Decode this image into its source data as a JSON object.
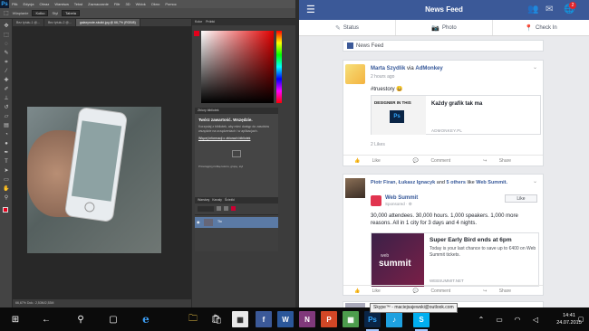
{
  "photoshop": {
    "logo": "Ps",
    "menu": [
      "Plik",
      "Edycja",
      "Obraz",
      "Warstwa",
      "Tekst",
      "Zaznaczanie",
      "Filtr",
      "3D",
      "Widok",
      "Okno",
      "Pomoc"
    ],
    "options": {
      "mode_label": "Wtapianie",
      "mode_value": "Kolko",
      "style_label": "Styl",
      "style_value": "Tabela"
    },
    "tabs": [
      "Bez tytułu-1 @...",
      "Bez tytułu-2 @...",
      "galaxynote-skutki.jpg @ 66,7% (RGB/8)"
    ],
    "status": "66,67%   Dok.: 2,53M/2,53M",
    "panels": {
      "color_tab": "Kolor",
      "swatches_tab": "Próbki",
      "library_tab": "Zbiory bibliotek",
      "layers_tab": "Warstwy",
      "channels_tab": "Kanały",
      "paths_tab": "Ścieżki"
    },
    "library": {
      "heading": "Twórz zawartość. Wszędzie.",
      "body": "Korzystaj z bibliotek, aby mieć dostęp do zasobów wszędzie na urządzeniach i w aplikacjach.",
      "link": "Więcej informacji o zbiorach bibliotek",
      "footer": "Przeciągnij próbkę koloru, grupę, styl"
    },
    "layer_name": "Tło"
  },
  "facebook": {
    "title": "News Feed",
    "actions": [
      {
        "icon": "✎",
        "label": "Status"
      },
      {
        "icon": "📷",
        "label": "Photo"
      },
      {
        "icon": "📍",
        "label": "Check In"
      }
    ],
    "notifications_count": "2",
    "section_label": "News Feed",
    "post1": {
      "author": "Marta Szydlik",
      "via": "via",
      "page": "AdMonkey",
      "time": "2 hours ago",
      "text": "#truestory 😀",
      "link_image_text": "DESIGNER IN THIS",
      "link_title": "Każdy grafik tak ma",
      "link_domain": "ADMONKEY.PL",
      "likes": "2 Likes",
      "like": "Like",
      "comment": "Comment",
      "share": "Share"
    },
    "post2": {
      "author": "Piotr Firan",
      "others": "Łukasz Ignacyk",
      "and": "and",
      "more": "5 others",
      "like_text": "like",
      "page": "Web Summit.",
      "ws_name": "Web Summit",
      "sponsored": "Sponsored · ⚙",
      "like_button": "Like",
      "description": "30,000 attendees. 30,000 hours. 1,000 speakers. 1,000 more reasons. All in 1 city for 3 days and 4 nights.",
      "ad_image_small": "web",
      "ad_image_big": "summit",
      "ad_title": "Super Early Bird ends at 6pm",
      "ad_text": "Today is your last chance to save up to €400 on Web Summit tickets.",
      "ad_domain": "WEBSUMMIT.NET",
      "like": "Like",
      "comment": "Comment",
      "share": "Share"
    }
  },
  "tooltip": "Skype™ - maciejsajewski@outlook.com",
  "taskbar": {
    "time": "14:41",
    "date": "24.07.2015",
    "apps": [
      "⊞",
      "←",
      "⚲",
      "▢",
      "e",
      "🗀",
      "🛍",
      "f",
      "W",
      "N",
      "P",
      "▦",
      "Ps",
      "♪",
      "S"
    ]
  }
}
